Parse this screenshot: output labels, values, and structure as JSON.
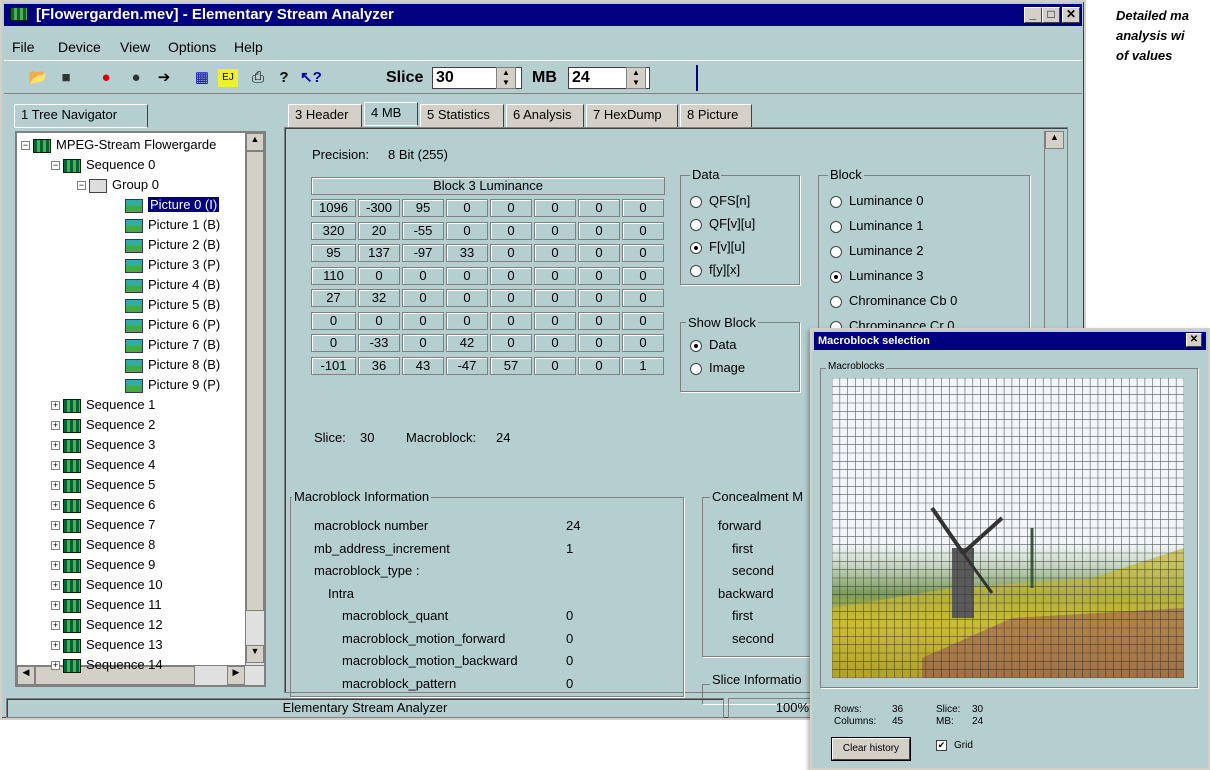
{
  "window": {
    "title": "[Flowergarden.mev] - Elementary Stream Analyzer"
  },
  "caption": [
    "Detailed ma",
    "analysis wi",
    "of values"
  ],
  "menu": [
    "File",
    "Device",
    "View",
    "Options",
    "Help"
  ],
  "toolbar": {
    "slice_label": "Slice",
    "slice_value": "30",
    "mb_label": "MB",
    "mb_value": "24"
  },
  "left_tab": "1 Tree Navigator",
  "tree": {
    "root": "MPEG-Stream Flowergarde",
    "sequence0": "Sequence 0",
    "group0": "Group 0",
    "pictures": [
      "Picture 0 (I)",
      "Picture 1 (B)",
      "Picture 2 (B)",
      "Picture 3 (P)",
      "Picture 4 (B)",
      "Picture 5 (B)",
      "Picture 6 (P)",
      "Picture 7 (B)",
      "Picture 8 (B)",
      "Picture 9 (P)"
    ],
    "sequences": [
      "Sequence 1",
      "Sequence 2",
      "Sequence 3",
      "Sequence 4",
      "Sequence 5",
      "Sequence 6",
      "Sequence 7",
      "Sequence 8",
      "Sequence 9",
      "Sequence 10",
      "Sequence 11",
      "Sequence 12",
      "Sequence 13",
      "Sequence 14"
    ]
  },
  "tabs": [
    "3 Header",
    "4 MB",
    "5 Statistics",
    "6 Analysis",
    "7 HexDump",
    "8 Picture"
  ],
  "mb": {
    "precision_label": "Precision:",
    "precision_value": "8 Bit (255)",
    "block_title": "Block 3 Luminance",
    "matrix": [
      [
        "1096",
        "-300",
        "95",
        "0",
        "0",
        "0",
        "0",
        "0"
      ],
      [
        "320",
        "20",
        "-55",
        "0",
        "0",
        "0",
        "0",
        "0"
      ],
      [
        "95",
        "137",
        "-97",
        "33",
        "0",
        "0",
        "0",
        "0"
      ],
      [
        "110",
        "0",
        "0",
        "0",
        "0",
        "0",
        "0",
        "0"
      ],
      [
        "27",
        "32",
        "0",
        "0",
        "0",
        "0",
        "0",
        "0"
      ],
      [
        "0",
        "0",
        "0",
        "0",
        "0",
        "0",
        "0",
        "0"
      ],
      [
        "0",
        "-33",
        "0",
        "42",
        "0",
        "0",
        "0",
        "0"
      ],
      [
        "-101",
        "36",
        "43",
        "-47",
        "57",
        "0",
        "0",
        "1"
      ]
    ],
    "data_group": {
      "label": "Data",
      "options": [
        "QFS[n]",
        "QF[v][u]",
        "F[v][u]",
        "f[y][x]"
      ]
    },
    "block_group": {
      "label": "Block",
      "options": [
        "Luminance 0",
        "Luminance 1",
        "Luminance 2",
        "Luminance 3",
        "Chrominance Cb 0",
        "Chrominance Cr 0"
      ]
    },
    "show_group": {
      "label": "Show Block",
      "options": [
        "Data",
        "Image"
      ]
    },
    "slice_label": "Slice:",
    "slice_value": "30",
    "macroblock_label": "Macroblock:",
    "macroblock_value": "24",
    "info_title": "Macroblock Information",
    "info_rows": [
      {
        "label": "macroblock number",
        "value": "24"
      },
      {
        "label": "mb_address_increment",
        "value": "1"
      },
      {
        "label": "macroblock_type :",
        "value": ""
      },
      {
        "label": "Intra",
        "value": ""
      },
      {
        "label": "macroblock_quant",
        "value": "0"
      },
      {
        "label": "macroblock_motion_forward",
        "value": "0"
      },
      {
        "label": "macroblock_motion_backward",
        "value": "0"
      },
      {
        "label": "macroblock_pattern",
        "value": "0"
      }
    ],
    "concealment_title": "Concealment M",
    "concealment_rows": [
      "forward",
      "first",
      "second",
      "backward",
      "first",
      "second"
    ],
    "slice_info_title": "Slice Informatio"
  },
  "status": {
    "text": "Elementary Stream Analyzer",
    "zoom": "100%"
  },
  "mb_window": {
    "title": "Macroblock selection",
    "group_label": "Macroblocks",
    "rows_label": "Rows:",
    "rows_value": "36",
    "columns_label": "Columns:",
    "columns_value": "45",
    "slice_label": "Slice:",
    "slice_value": "30",
    "mb_label": "MB:",
    "mb_value": "24",
    "clear_button": "Clear history",
    "grid_label": "Grid"
  },
  "colors": {
    "titlebar": "#000080",
    "window_bg": "#b5cfd0",
    "selection": "#000080"
  }
}
